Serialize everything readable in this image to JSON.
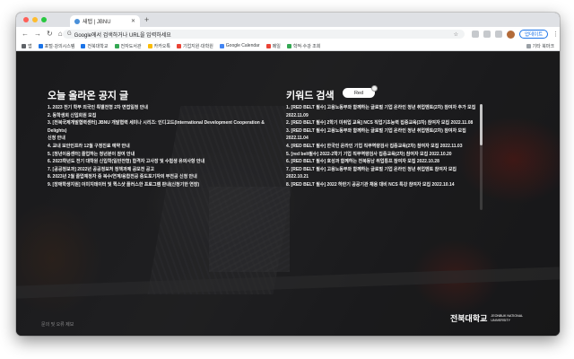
{
  "browser": {
    "tab_title": "새탭 | JBNU",
    "new_tab": "+",
    "back": "←",
    "forward": "→",
    "reload": "↻",
    "home": "⌂",
    "url": "Google에서 검색하거나 URL을 입력하세요",
    "update_label": "업데이트",
    "bookmarks": [
      {
        "label": "앱",
        "color": "#5f6368"
      },
      {
        "label": "포털·강의시스템",
        "color": "#1a73e8"
      },
      {
        "label": "전북대학교",
        "color": "#1a73e8"
      },
      {
        "label": "전자도서관",
        "color": "#34a853"
      },
      {
        "label": "카카오톡",
        "color": "#fbbc04"
      },
      {
        "label": "기업지원·대학원",
        "color": "#ea4335"
      },
      {
        "label": "Google Calendar",
        "color": "#4285f4"
      },
      {
        "label": "메일",
        "color": "#ea4335"
      },
      {
        "label": "학적·수강 조회",
        "color": "#34a853"
      }
    ],
    "bookmarks_other": "기타 북마크"
  },
  "page": {
    "notice_title": "오늘 올라온 공지 글",
    "keyword_title": "키워드 검색",
    "keyword_toggle": "Red",
    "notices": [
      "1. 2023 전기 학부 외국인 특별전형 2차 면접일정 안내",
      "2. 동학생회 신입회원 모집",
      "3. [전북국제개발협력센터] JBNU 개발협력 세미나 시리즈: 인디고드(International Development Cooperation & Delights)",
      "신청 안내",
      "4. 교내 보안인프라 12월 구정진료 예약 안내",
      "5. [정년이음센터] 졸업하는 청년분이 참여 안내",
      "6. 2023학년도 전기 대학원 신입학(일반전형) 합격자 고사장 및 수험생 유의사항 안내",
      "7. [공공정보과] 2022년 공공정보처 정책과제 공모전 공고",
      "8. 2023년 2월 졸업예정자 중 복수/연계/융합전공 중도포기자의 부전공 신청 안내",
      "9. [장애학생지원] 이미지데이터 및 퀵스샷 플러스한 프로그램 판내(신청기한 연장)"
    ],
    "keyword_results": [
      "1. [RED BELT 필수] 고용노동부와 함께하는 글로벌 기업 온라인 청년 취업멘토(2차) 참여자 추가 모집",
      "2022.11.09",
      "2. [RED BELT 필수] 2학기 미취업 교육] NCS 직업기초능력 집중교육(3차) 참여자 모집 2022.11.08",
      "3. [RED BELT 필수] 고용노동부와 함께하는 글로벌 기업 온라인 청년 취업멘토(2차) 참여자 모집",
      "2022.11.04",
      "4. [RED BELT 필수] 한국인 온라인 기업 직무역량검사 집중교육(2차) 참여자 모집 2022.11.03",
      "5. [red belt필수] 2022-2학기 기업 직무역량검사 집중교육(2차) 참여자 모집 2022.10.20",
      "6. [RED BELT 필수] 호성과 함께하는 전북동남 취업통프 참여자 모집 2022.10.28",
      "7. [RED BELT 필수] 고용노동부와 함께하는 글로벌 기업 온라인 청년 취업멘토 참여자 모집",
      "2022.10.21",
      "8. [RED BELT 필수] 2022 하반기 공공기관 채용 대비 NCS 특강 참여자 모집 2022.10.14"
    ],
    "footer_link": "문의 및 오류 제보",
    "logo_korean": "전북대학교",
    "logo_english": "JEONBUK NATIONAL UNIVERSITY"
  },
  "colors": {
    "close": "#ff5f57",
    "minimize": "#febc2e",
    "maximize": "#28c840",
    "accent": "#1a73e8"
  }
}
